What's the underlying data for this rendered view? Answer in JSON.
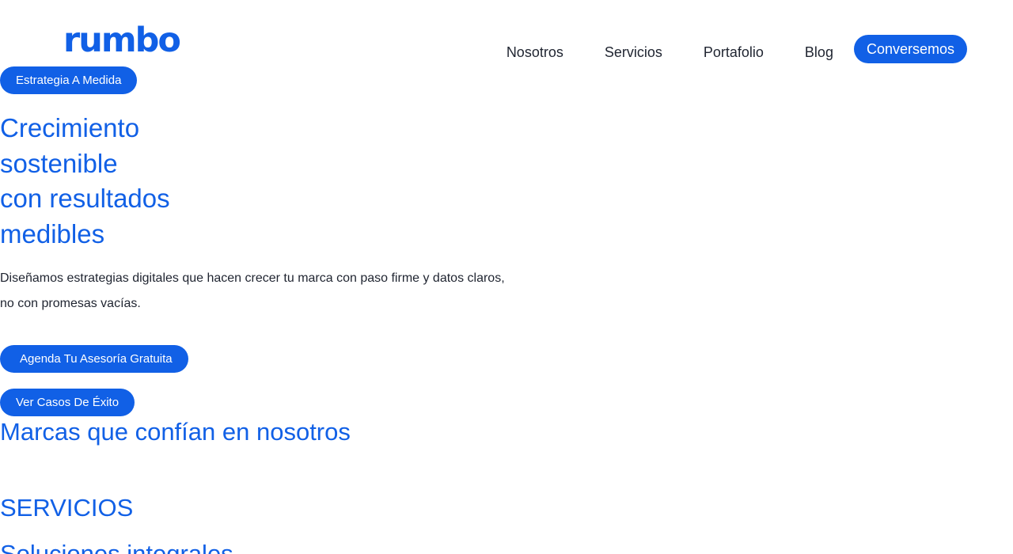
{
  "header": {
    "logo_text": "rumbo",
    "nav": [
      "Nosotros",
      "Servicios",
      "Portafolio",
      "Blog"
    ],
    "cta_label": "Conversemos"
  },
  "hero": {
    "badge": "Estrategia A Medida",
    "title_lines": [
      "Crecimiento",
      "sostenible",
      "con resultados",
      "medibles"
    ],
    "subtitle": "Diseñamos estrategias digitales que hacen crecer tu marca con paso firme y datos claros, no con promesas vacías.",
    "primary_button": "Agenda Tu Asesoría Gratuita",
    "secondary_button": "Ver Casos De Éxito"
  },
  "brands": {
    "title": "Marcas que confían en nosotros"
  },
  "services": {
    "label": "SERVICIOS",
    "title": "Soluciones integrales"
  },
  "colors": {
    "brand": "#1160e6",
    "text": "#1f2430",
    "background": "#ffffff"
  }
}
